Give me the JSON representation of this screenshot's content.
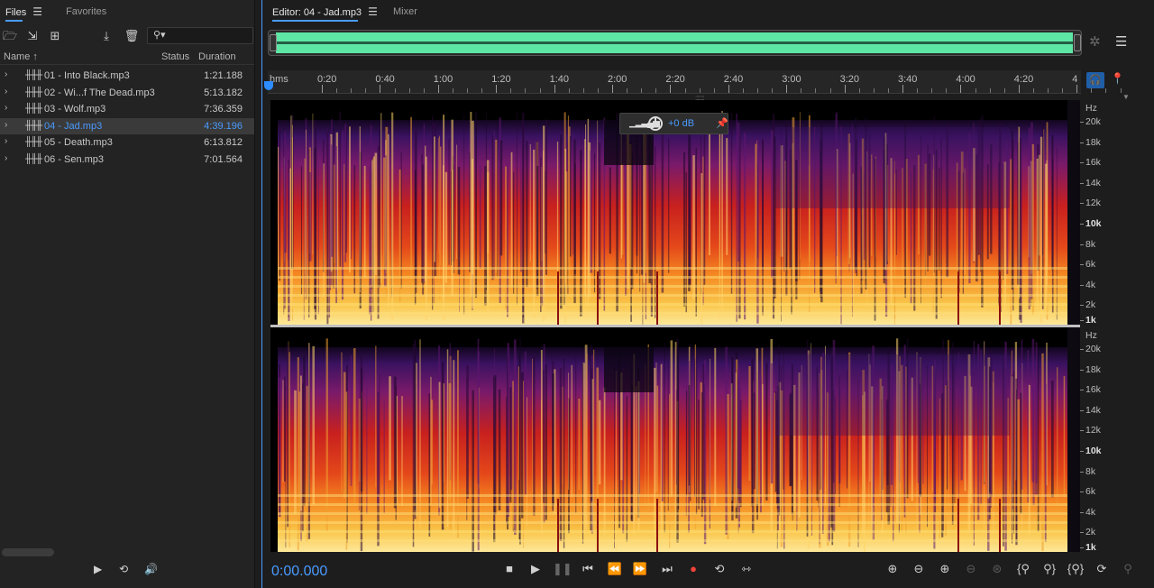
{
  "left_panel": {
    "tabs": [
      {
        "label": "Files",
        "active": true
      },
      {
        "label": "Favorites",
        "active": false
      }
    ],
    "search_placeholder": "",
    "columns": {
      "name": "Name",
      "status": "Status",
      "duration": "Duration"
    },
    "files": [
      {
        "name": "01 - Into Black.mp3",
        "duration": "1:21.188",
        "selected": false
      },
      {
        "name": "02 - Wi...f The Dead.mp3",
        "duration": "5:13.182",
        "selected": false
      },
      {
        "name": "03 - Wolf.mp3",
        "duration": "7:36.359",
        "selected": false
      },
      {
        "name": "04 - Jad.mp3",
        "duration": "4:39.196",
        "selected": true
      },
      {
        "name": "05 - Death.mp3",
        "duration": "6:13.812",
        "selected": false
      },
      {
        "name": "06 - Sen.mp3",
        "duration": "7:01.564",
        "selected": false
      }
    ]
  },
  "editor": {
    "tabs": [
      {
        "label": "Editor: 04 - Jad.mp3",
        "active": true
      },
      {
        "label": "Mixer",
        "active": false
      }
    ],
    "ruler": {
      "unit_label": "hms",
      "labels": [
        "0:20",
        "0:40",
        "1:00",
        "1:20",
        "1:40",
        "2:00",
        "2:20",
        "2:40",
        "3:00",
        "3:20",
        "3:40",
        "4:00",
        "4:20",
        "4"
      ]
    },
    "hud": {
      "gain": "+0 dB"
    },
    "freq_axis": {
      "unit": "Hz",
      "labels": [
        "20k",
        "18k",
        "16k",
        "14k",
        "12k",
        "10k",
        "8k",
        "6k",
        "4k",
        "2k",
        "1k"
      ]
    },
    "time_display": "0:00.000"
  },
  "colors": {
    "accent": "#4a9bff",
    "overview_wave": "#5de6a4",
    "record": "#f0433a"
  }
}
